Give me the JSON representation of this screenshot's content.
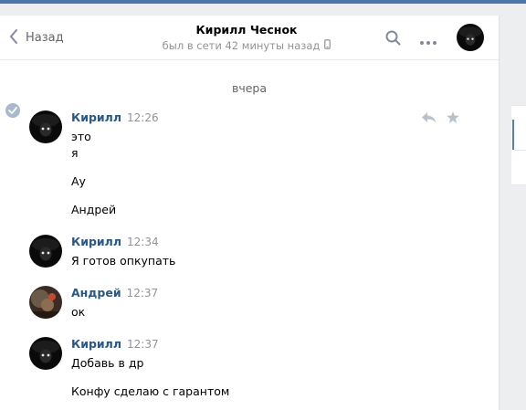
{
  "header": {
    "back_label": "Назад",
    "title": "Кирилл Чеснок",
    "status": "был в сети 42 минуты назад"
  },
  "date_separator": "вчера",
  "messages": [
    {
      "author": "Кирилл",
      "time": "12:26",
      "lines": [
        "это",
        "я",
        "Ау",
        "Андрей"
      ]
    },
    {
      "author": "Кирилл",
      "time": "12:34",
      "lines": [
        "Я готов опкупать"
      ]
    },
    {
      "author": "Андрей",
      "time": "12:37",
      "lines": [
        "ок"
      ]
    },
    {
      "author": "Кирилл",
      "time": "12:37",
      "lines": [
        "Добавь в др",
        "Конфу сделаю с гарантом"
      ]
    }
  ],
  "icons": {
    "back": "chevron-left-icon",
    "mobile": "mobile-phone-icon",
    "search": "search-icon",
    "more": "more-dots-icon",
    "reply": "reply-icon",
    "star": "star-icon",
    "read": "check-circle-icon"
  },
  "colors": {
    "accent": "#2a5885",
    "topbar": "#4a76a8",
    "muted": "#939393",
    "background": "#edeef0"
  }
}
